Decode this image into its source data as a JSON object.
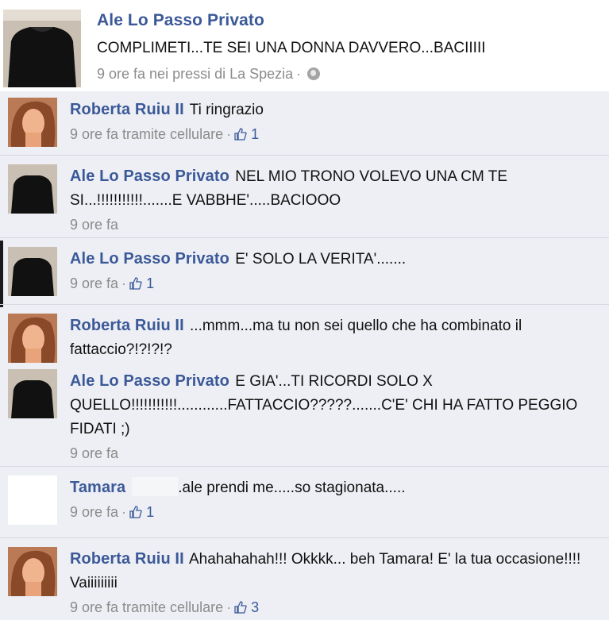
{
  "post": {
    "author": "Ale Lo Passo Privato",
    "message": "COMPLIMETI...TE SEI UNA DONNA DAVVERO...BACIIIII",
    "meta": "9 ore fa nei pressi di La Spezia",
    "avatar_icon": "person-silhouette-avatar",
    "privacy_icon": "globe-icon"
  },
  "comments": [
    {
      "author": "Roberta Ruiu II",
      "text": "Ti ringrazio",
      "meta": "9 ore fa tramite cellulare",
      "likes": "1",
      "avatar": "woman-photo-avatar"
    },
    {
      "author": "Ale Lo Passo Privato",
      "text": "NEL MIO TRONO VOLEVO UNA CM TE SI...!!!!!!!!!!!.......E VABBHE'.....BACIOOO",
      "meta": "9 ore fa",
      "likes": "",
      "avatar": "person-silhouette-avatar"
    },
    {
      "author": "Ale Lo Passo Privato",
      "text": "E' SOLO LA VERITA'.......",
      "meta": "9 ore fa",
      "likes": "1",
      "avatar": "person-silhouette-avatar"
    },
    {
      "author": "Roberta Ruiu II",
      "text": "...mmm...ma tu non sei quello che ha combinato il fattaccio?!?!?!?",
      "meta": "",
      "likes": "",
      "avatar": "woman-photo-avatar"
    },
    {
      "author": "Ale Lo Passo Privato",
      "text": "E GIA'...TI RICORDI SOLO X QUELLO!!!!!!!!!!!............FATTACCIO?????.......C'E' CHI HA FATTO PEGGIO FIDATI ;)",
      "meta": "9 ore fa",
      "likes": "",
      "avatar": "person-silhouette-avatar"
    },
    {
      "author": "Tamara",
      "text": ".ale prendi me.....so stagionata.....",
      "meta": "9 ore fa",
      "likes": "1",
      "avatar": "blank-avatar"
    },
    {
      "author": "Roberta Ruiu II",
      "text": "Ahahahahah!!! Okkkk... beh Tamara! E' la tua occasione!!!! Vaiiiiiiiii",
      "meta": "9 ore fa tramite cellulare",
      "likes": "3",
      "avatar": "woman-photo-avatar"
    }
  ],
  "colors": {
    "link": "#3b5998",
    "comment_bg": "#edeff4",
    "meta": "#8b8b8b"
  }
}
